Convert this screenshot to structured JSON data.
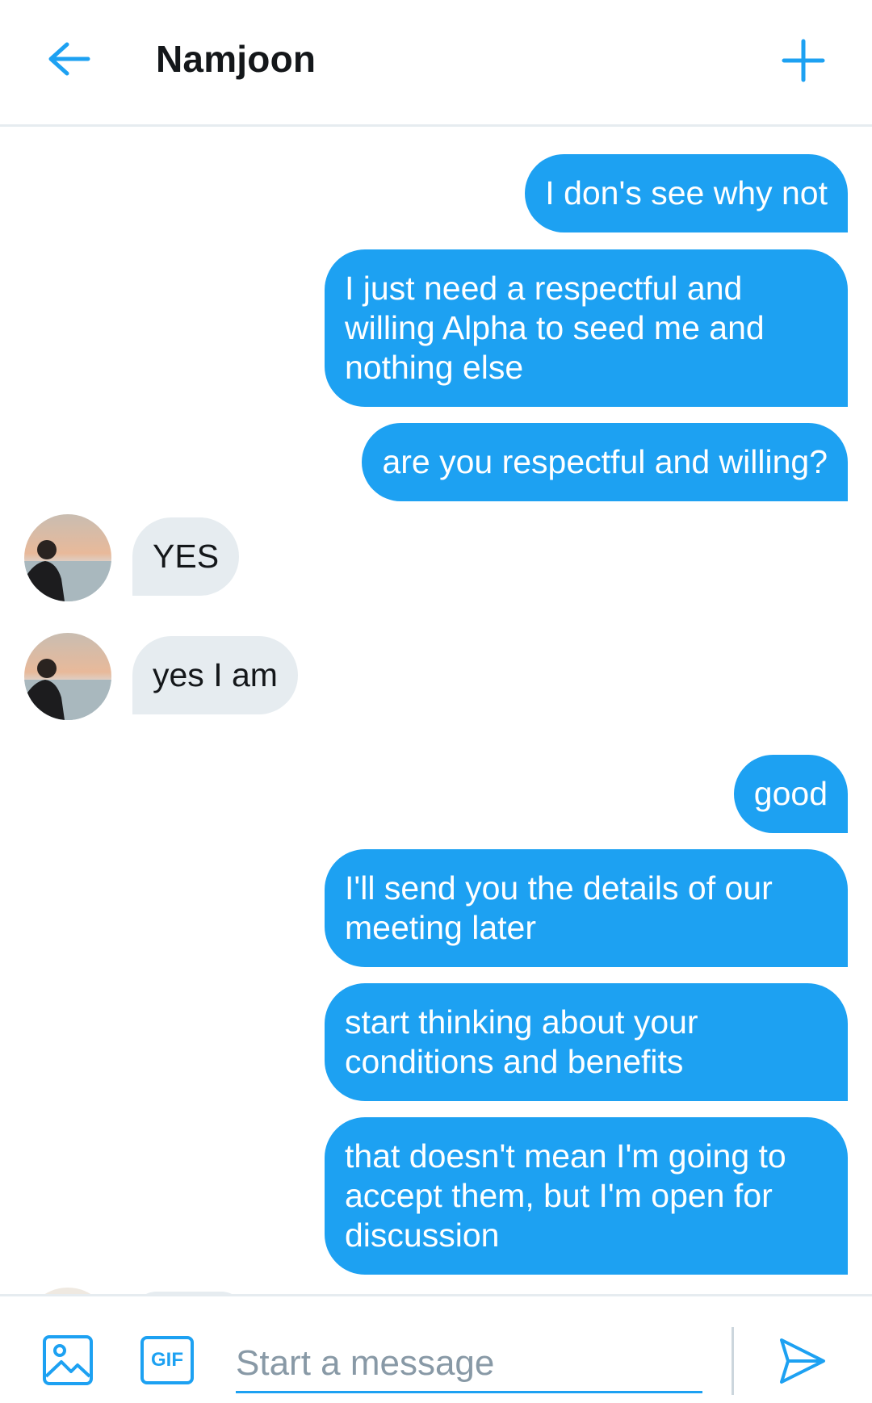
{
  "header": {
    "title": "Namjoon",
    "back_icon": "arrow-left-icon",
    "add_icon": "plus-icon"
  },
  "messages": [
    {
      "direction": "outgoing",
      "text": "I don's see why not"
    },
    {
      "direction": "outgoing",
      "text": "I just need a respectful and willing Alpha to seed me and nothing else"
    },
    {
      "direction": "outgoing",
      "text": "are you respectful and willing?"
    },
    {
      "direction": "incoming",
      "text": "YES"
    },
    {
      "direction": "incoming",
      "text": "yes I am"
    },
    {
      "direction": "outgoing",
      "text": "good"
    },
    {
      "direction": "outgoing",
      "text": "I'll send you the details of our meeting later"
    },
    {
      "direction": "outgoing",
      "text": "start thinking about your conditions and benefits"
    },
    {
      "direction": "outgoing",
      "text": "that doesn't mean I'm going to accept them, but I'm open for discussion"
    }
  ],
  "composer": {
    "placeholder": "Start a message",
    "gif_label": "GIF",
    "image_icon": "image-icon",
    "send_icon": "send-icon"
  },
  "colors": {
    "accent": "#1da1f2",
    "incoming_bubble": "#e6ecf0",
    "divider": "#e6ecf0",
    "placeholder": "#8899a6"
  }
}
